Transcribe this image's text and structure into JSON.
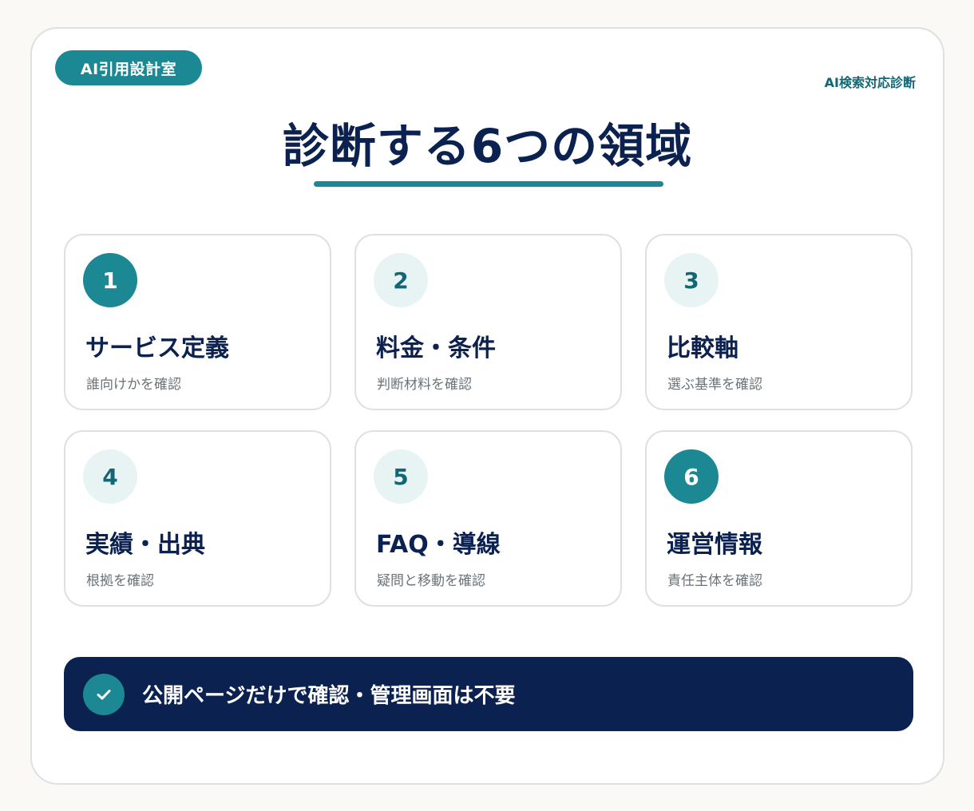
{
  "header": {
    "brand": "AI引用設計室",
    "tag": "AI検索対応診断",
    "title": "診断する6つの領域"
  },
  "areas": [
    {
      "number": "1",
      "title": "サービス定義",
      "description": "誰向けかを確認",
      "highlighted": true
    },
    {
      "number": "2",
      "title": "料金・条件",
      "description": "判断材料を確認",
      "highlighted": false
    },
    {
      "number": "3",
      "title": "比較軸",
      "description": "選ぶ基準を確認",
      "highlighted": false
    },
    {
      "number": "4",
      "title": "実績・出典",
      "description": "根拠を確認",
      "highlighted": false
    },
    {
      "number": "5",
      "title": "FAQ・導線",
      "description": "疑問と移動を確認",
      "highlighted": false
    },
    {
      "number": "6",
      "title": "運営情報",
      "description": "責任主体を確認",
      "highlighted": true
    }
  ],
  "banner": {
    "icon": "check-icon",
    "text": "公開ページだけで確認・管理画面は不要"
  },
  "colors": {
    "accent": "#1b8893",
    "navy": "#0b2150",
    "soft_teal": "#e8f4f4"
  }
}
